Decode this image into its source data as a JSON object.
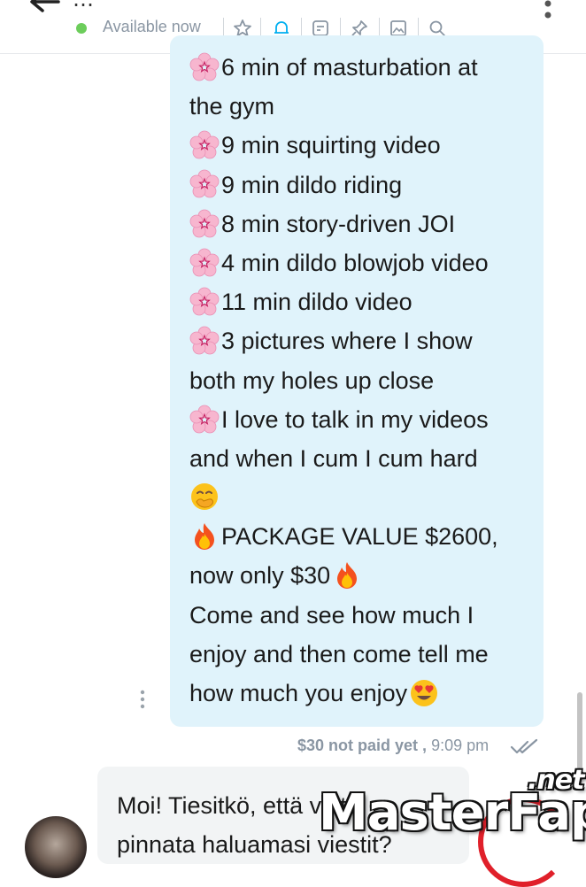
{
  "header": {
    "back_icon": "arrow-left-icon",
    "title_fragment": "…  ·  ·",
    "status_text": "Available now",
    "status_color": "#6ccd5b",
    "actions": [
      "star-icon",
      "bell-icon",
      "note-icon",
      "pin-icon",
      "gallery-icon",
      "search-icon"
    ],
    "more_icon": "more-vertical-icon"
  },
  "outgoing_message": {
    "lines": [
      {
        "emoji": "cherry-blossom",
        "text": "6 min of masturbation at"
      },
      {
        "text": "the gym"
      },
      {
        "emoji": "cherry-blossom",
        "text": "9 min squirting video"
      },
      {
        "emoji": "cherry-blossom",
        "text": "9 min dildo riding"
      },
      {
        "emoji": "cherry-blossom",
        "text": "8 min story-driven JOI"
      },
      {
        "emoji": "cherry-blossom",
        "text": "4 min dildo blowjob video"
      },
      {
        "emoji": "cherry-blossom",
        "text": "11 min dildo video"
      },
      {
        "emoji": "cherry-blossom",
        "text": "3 pictures where I show"
      },
      {
        "text": "both my holes up close"
      },
      {
        "emoji": "cherry-blossom",
        "text": "I love to talk in my videos"
      },
      {
        "text": "and when I cum I cum hard"
      },
      {
        "emoji": "hand-over-mouth"
      },
      {
        "emoji": "fire",
        "text": "PACKAGE VALUE $2600,"
      },
      {
        "text": "now only $30",
        "emoji_after": "fire"
      },
      {
        "text": "Come and see how much I"
      },
      {
        "text": "enjoy and then come tell me"
      },
      {
        "text": "how much you enjoy",
        "emoji_after": "heart-eyes"
      }
    ],
    "price_status": "$30 not paid yet ,",
    "time": "9:09 pm",
    "read_icon": "double-check-icon"
  },
  "incoming_message": {
    "line1": "Moi! Tiesitkö, että voit",
    "line2": "pinnata haluamasi viestit?"
  },
  "watermark": {
    "main": "MasterFap",
    "suffix": ".net"
  }
}
